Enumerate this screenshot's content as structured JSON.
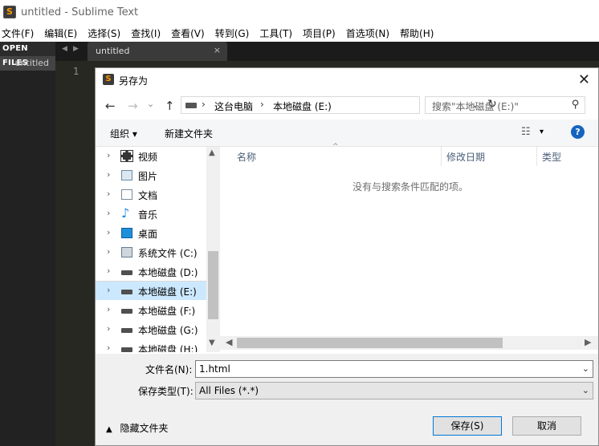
{
  "window": {
    "title": "untitled - Sublime Text",
    "app_icon_glyph": "S"
  },
  "menu": [
    "文件(F)",
    "编辑(E)",
    "选择(S)",
    "查找(I)",
    "查看(V)",
    "转到(G)",
    "工具(T)",
    "项目(P)",
    "首选项(N)",
    "帮助(H)"
  ],
  "sidebar": {
    "header": "OPEN FILES",
    "files": [
      "untitled"
    ]
  },
  "editor": {
    "tab_prev": "◀",
    "tab_next": "▶",
    "tab_label": "untitled",
    "tab_close": "×",
    "line_number": "1"
  },
  "dialog": {
    "title": "另存为",
    "close": "✕",
    "nav": {
      "back": "←",
      "forward": "→",
      "dropdown": "⌄",
      "up": "↑"
    },
    "address": {
      "sep1": "›",
      "seg1": "这台电脑",
      "sep2": "›",
      "seg2": "本地磁盘 (E:)",
      "drop": "⌄",
      "refresh": "↻"
    },
    "search_placeholder": "搜索\"本地磁盘 (E:)\"",
    "toolbar": {
      "organize": "组织 ▾",
      "new_folder": "新建文件夹",
      "view": "☷",
      "view_drop": "▾",
      "help": "?"
    },
    "nav_pane": [
      {
        "label": "视频",
        "icon": "video-icon"
      },
      {
        "label": "图片",
        "icon": "picture-icon"
      },
      {
        "label": "文档",
        "icon": "document-icon"
      },
      {
        "label": "音乐",
        "icon": "music-icon"
      },
      {
        "label": "桌面",
        "icon": "desktop-icon"
      },
      {
        "label": "系统文件 (C:)",
        "icon": "system-drive-icon"
      },
      {
        "label": "本地磁盘 (D:)",
        "icon": "drive-icon"
      },
      {
        "label": "本地磁盘 (E:)",
        "icon": "drive-icon",
        "selected": true
      },
      {
        "label": "本地磁盘 (F:)",
        "icon": "drive-icon"
      },
      {
        "label": "本地磁盘 (G:)",
        "icon": "drive-icon"
      },
      {
        "label": "本地磁盘 (H:)",
        "icon": "drive-icon"
      }
    ],
    "nav_chevron": "›",
    "columns": {
      "sort_indicator": "^",
      "name": "名称",
      "modified": "修改日期",
      "type": "类型"
    },
    "empty_message": "没有与搜索条件匹配的项。",
    "scroll": {
      "up": "▲",
      "down": "▼",
      "left": "◀",
      "right": "▶"
    },
    "filename_label": "文件名(N):",
    "filename_value": "1.html",
    "filetype_label": "保存类型(T):",
    "filetype_value": "All Files (*.*)",
    "combo_drop": "⌄",
    "hide_folders": "隐藏文件夹",
    "hide_chevron": "▲",
    "save_button": "保存(S)",
    "cancel_button": "取消"
  }
}
